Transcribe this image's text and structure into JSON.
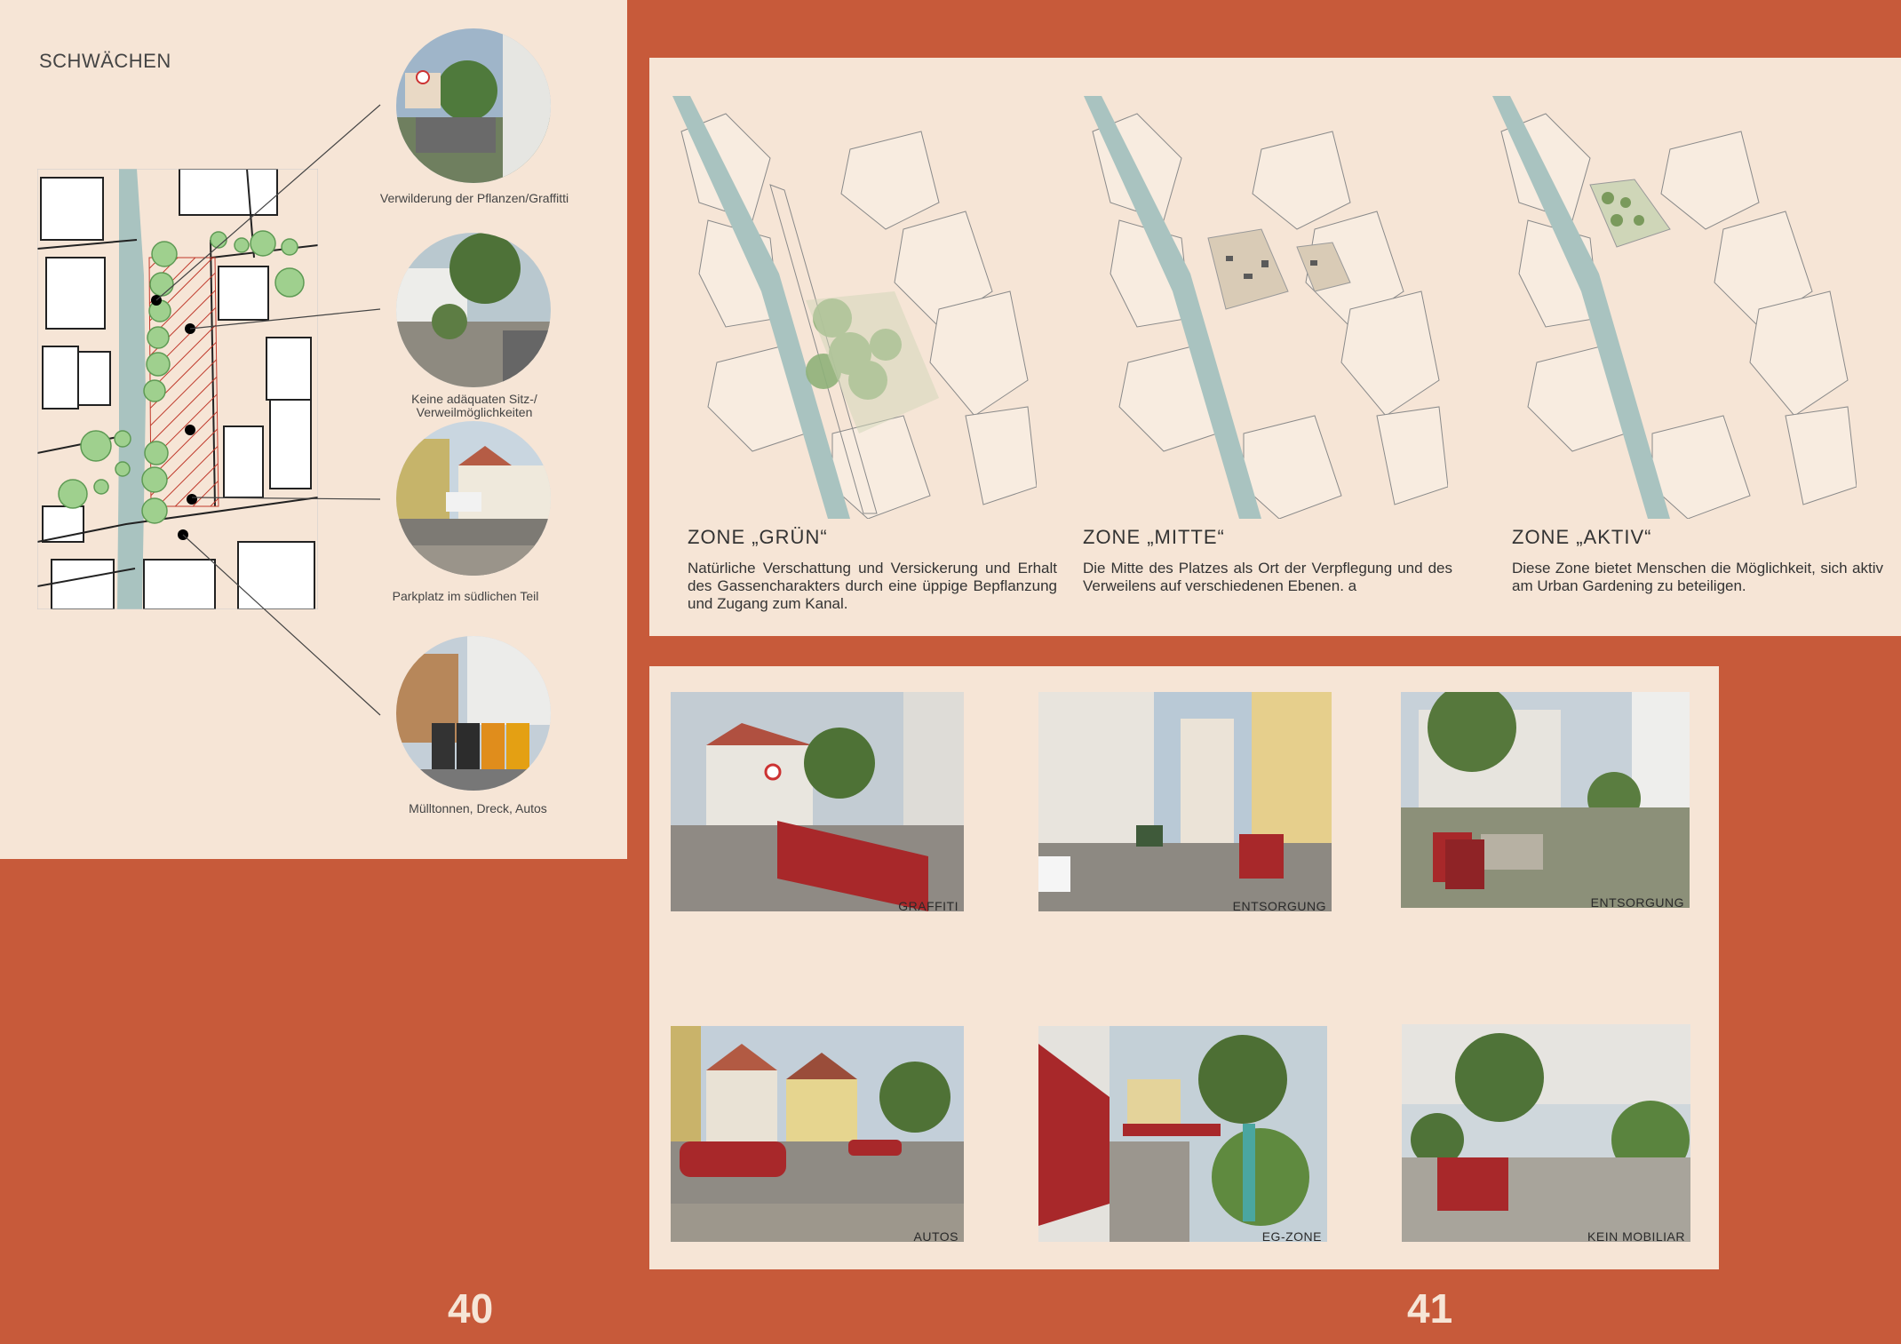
{
  "left_page": {
    "heading": "SCHWÄCHEN",
    "captions": [
      "Verwilderung der Pflanzen/Graffitti",
      "Keine adäquaten Sitz-/ Verweilmöglichkeiten",
      "Parkplatz im südlichen Teil",
      "Mülltonnen, Dreck, Autos"
    ],
    "page_number": "40"
  },
  "zones": [
    {
      "title": "ZONE „GRÜN“",
      "text": "Natürliche Verschattung und Versickerung und Erhalt des Gassencharakters durch eine üppige Bepflanzung und Zugang zum Kanal."
    },
    {
      "title": "ZONE „MITTE“",
      "text": "Die Mitte des Platzes als Ort der Verpflegung und des Verweilens auf verschiedenen Ebenen. a"
    },
    {
      "title": "ZONE „AKTIV“",
      "text": "Diese Zone bietet Menschen die Möglichkeit, sich aktiv am Urban Gardening zu beteiligen."
    }
  ],
  "photos": [
    {
      "label": "GRAFFITI"
    },
    {
      "label": "ENTSORGUNG"
    },
    {
      "label": "ENTSORGUNG"
    },
    {
      "label": "AUTOS"
    },
    {
      "label": "EG-ZONE"
    },
    {
      "label": "KEIN MOBILIAR"
    }
  ],
  "right_page": {
    "page_number": "41"
  },
  "colors": {
    "accent": "#c75a3a",
    "paper": "#f6e5d6",
    "highlight": "#a8282a",
    "canal": "#a9c3c0",
    "tree": "#9fd08e"
  }
}
